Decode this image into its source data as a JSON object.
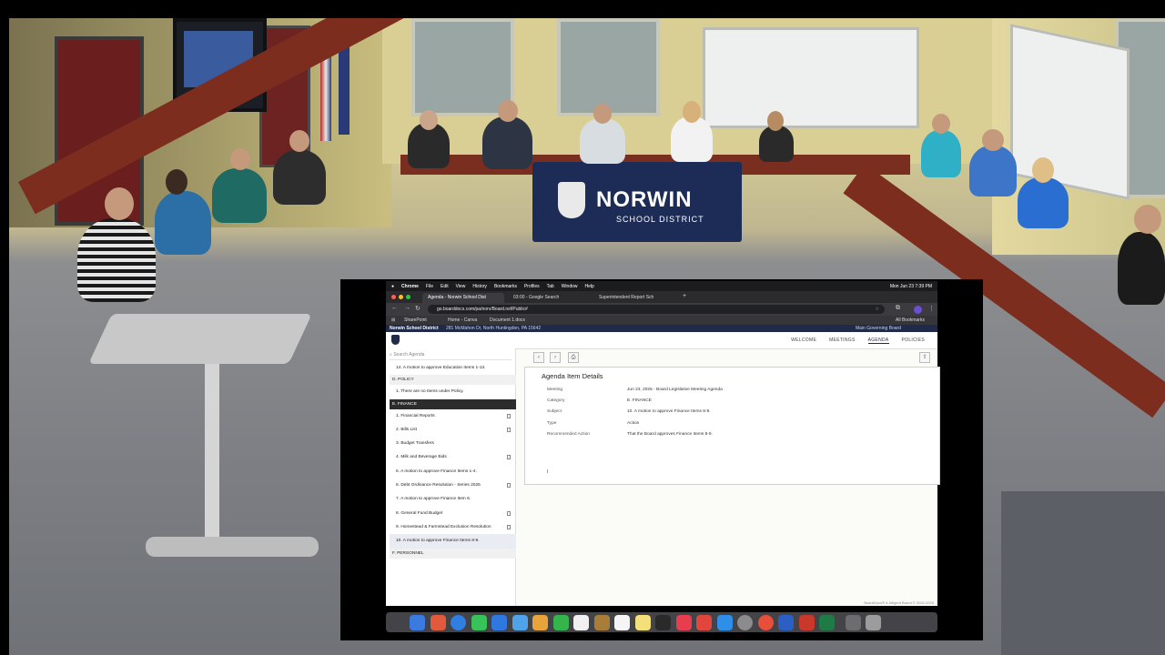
{
  "scene": {
    "skirt_text": "NORWIN",
    "skirt_subtext": "SCHOOL DISTRICT"
  },
  "mac": {
    "menu": [
      "Chrome",
      "File",
      "Edit",
      "View",
      "History",
      "Bookmarks",
      "Profiles",
      "Tab",
      "Window",
      "Help"
    ],
    "clock": "Mon Jun 23  7:39 PM"
  },
  "browser": {
    "tabs": [
      {
        "label": "Agenda - Norwin School Dist",
        "active": true
      },
      {
        "label": "03:00 - Google Search",
        "active": false
      },
      {
        "label": "Superintendent Report Sch",
        "active": false
      }
    ],
    "url": "go.boarddocs.com/pa/norv/Board.nsf/Public#",
    "bookmarks": [
      "SharePoint",
      "Home - Canva",
      "Document 1.docx"
    ],
    "all_bookmarks": "All Bookmarks"
  },
  "site": {
    "district": "Norwin School District",
    "address": "281 McMahon Dr, North Huntingdon, PA 15642",
    "top_right": "Main Governing Board",
    "nav": [
      "WELCOME",
      "MEETINGS",
      "AGENDA",
      "POLICIES"
    ],
    "search_placeholder": "Search Agenda",
    "agenda": [
      {
        "type": "item",
        "label": "14. A motion to approve Education Items 1-13.",
        "doc": false
      },
      {
        "type": "sec-light",
        "label": "D. POLICY"
      },
      {
        "type": "item",
        "label": "1. There are no Items under Policy.",
        "doc": false
      },
      {
        "type": "sec",
        "label": "E. FINANCE"
      },
      {
        "type": "item",
        "label": "1. Financial Reports",
        "doc": true
      },
      {
        "type": "item",
        "label": "2. Bills List",
        "doc": true
      },
      {
        "type": "item",
        "label": "3. Budget Transfers",
        "doc": false
      },
      {
        "type": "item",
        "label": "4. Milk and Beverage Bids",
        "doc": true
      },
      {
        "type": "item",
        "label": "5. A motion to approve Finance Items 1-4.",
        "doc": false
      },
      {
        "type": "item",
        "label": "6. Debt Ordinance Resolution - Series 2025",
        "doc": true
      },
      {
        "type": "item",
        "label": "7. A motion to approve Finance Item 6.",
        "doc": false
      },
      {
        "type": "item",
        "label": "8. General Fund Budget",
        "doc": true
      },
      {
        "type": "item",
        "label": "9. Homestead & Farmstead Exclusion Resolution",
        "doc": true
      },
      {
        "type": "item",
        "label": "10. A motion to approve Finance Items 8-9.",
        "doc": false,
        "selected": true
      },
      {
        "type": "sec-light",
        "label": "F. PERSONNEL"
      }
    ],
    "detail": {
      "title": "Agenda Item Details",
      "fields": [
        {
          "k": "Meeting",
          "v": "Jun 23, 2025 - Board Legislative Meeting Agenda"
        },
        {
          "k": "Category",
          "v": "E. FINANCE"
        },
        {
          "k": "Subject",
          "v": "10. A motion to approve Finance Items 8-9."
        },
        {
          "k": "Type",
          "v": "Action"
        },
        {
          "k": "Recommended Action",
          "v": "That the Board approves Finance Items 8-9."
        }
      ],
      "cursor": "I"
    },
    "footer": "BoardDocs® A Diligent Brand © 2002-2025"
  }
}
